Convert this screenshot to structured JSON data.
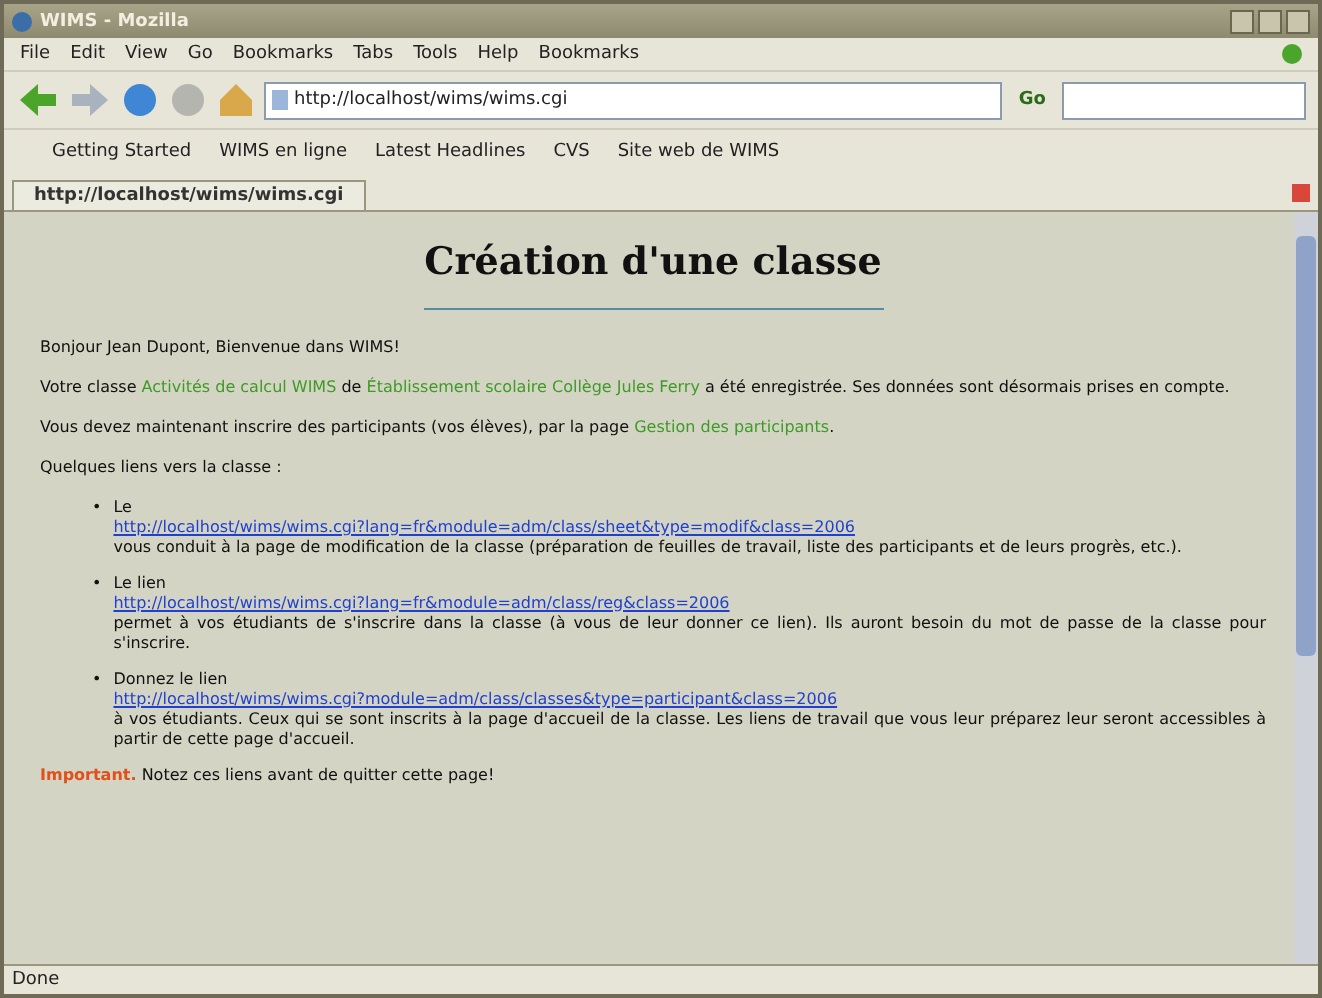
{
  "window": {
    "title": "WIMS - Mozilla"
  },
  "menu": [
    "File",
    "Edit",
    "View",
    "Go",
    "Bookmarks",
    "Tabs",
    "Tools",
    "Help",
    "Bookmarks"
  ],
  "address": {
    "value": "http://localhost/wims/wims.cgi"
  },
  "go_label": "Go",
  "bookmarks": [
    "Getting Started",
    "WIMS en ligne",
    "Latest Headlines",
    "CVS",
    "Site web de WIMS"
  ],
  "tab": {
    "label": "http://localhost/wims/wims.cgi",
    "selected": true
  },
  "page": {
    "title": "Création d'une classe",
    "greeting": "Bonjour Jean Dupont, Bienvenue dans WIMS!",
    "p1": "Votre classe **Activités de calcul WIMS** de **Établissement scolaire Collège Jules Ferry** a été enregistrée. Ses données sont désormais prises en compte.",
    "p2": "Vous devez maintenant inscrire des participants (vos élèves), par la page **Gestion des participants**.",
    "intro": "Quelques liens vers la classe :",
    "items": [
      {
        "marker": "•",
        "before": "Le",
        "link": "http://localhost/wims/wims.cgi?lang=fr&module=adm/class/sheet&type=modif&class=2006",
        "after": "vous conduit à la page de modification de la classe (préparation de feuilles de travail, liste des participants et de leurs progrès, etc.)."
      },
      {
        "marker": "•",
        "before": "Le lien",
        "link": "http://localhost/wims/wims.cgi?lang=fr&module=adm/class/reg&class=2006",
        "after": "permet à vos étudiants de s'inscrire dans la classe (à vous de leur donner ce lien). Ils auront besoin du mot de passe de la classe pour s'inscrire."
      },
      {
        "marker": "•",
        "before": "Donnez",
        "mid": "le",
        "end": "lien",
        "link": "http://localhost/wims/wims.cgi?module=adm/class/classes&type=participant&class=2006",
        "after": "à vos étudiants. Ceux qui se sont inscrits à la page d'accueil de la classe. Les liens de travail que vous leur préparez leur seront accessibles à partir de cette page d'accueil."
      }
    ],
    "important_label": "Important.",
    "important": "Notez ces liens avant de quitter cette page!"
  },
  "status": "Done"
}
